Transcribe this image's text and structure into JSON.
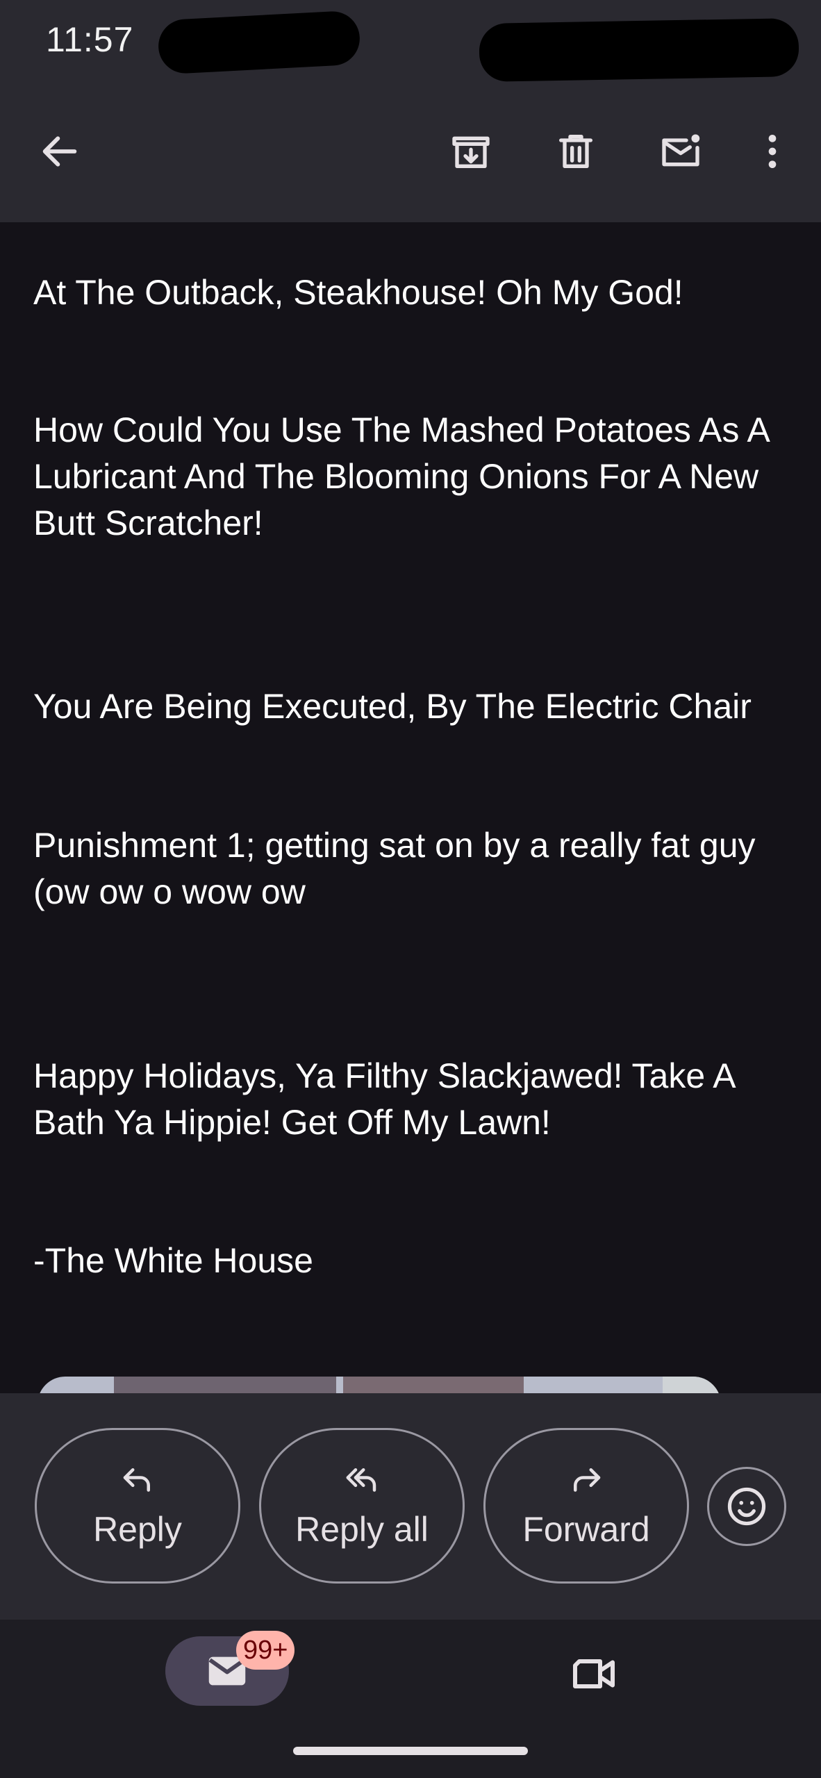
{
  "status_bar": {
    "time": "11:57"
  },
  "top_bar": {
    "icons": [
      "back-arrow-icon",
      "archive-icon",
      "delete-icon",
      "mark-unread-icon",
      "more-vert-icon"
    ]
  },
  "email": {
    "paragraphs": [
      "At The Outback, Steakhouse! Oh My God!",
      "How Could You Use The Mashed Potatoes As A Lubricant And The Blooming Onions For A New Butt Scratcher!",
      "You Are Being Executed, By The Electric Chair",
      "Punishment 1; getting sat on by a really fat guy (ow ow o wow ow",
      "Happy Holidays, Ya Filthy Slackjawed! Take A Bath Ya Hippie! Get Off My Lawn!",
      "-The White House"
    ]
  },
  "actions": {
    "reply": "Reply",
    "reply_all": "Reply all",
    "forward": "Forward"
  },
  "bottom_nav": {
    "mail_badge": "99+"
  },
  "colors": {
    "background": "#141218",
    "bar": "#2a2930",
    "badge": "#ffb4ab",
    "active_pill": "#4a4458"
  }
}
